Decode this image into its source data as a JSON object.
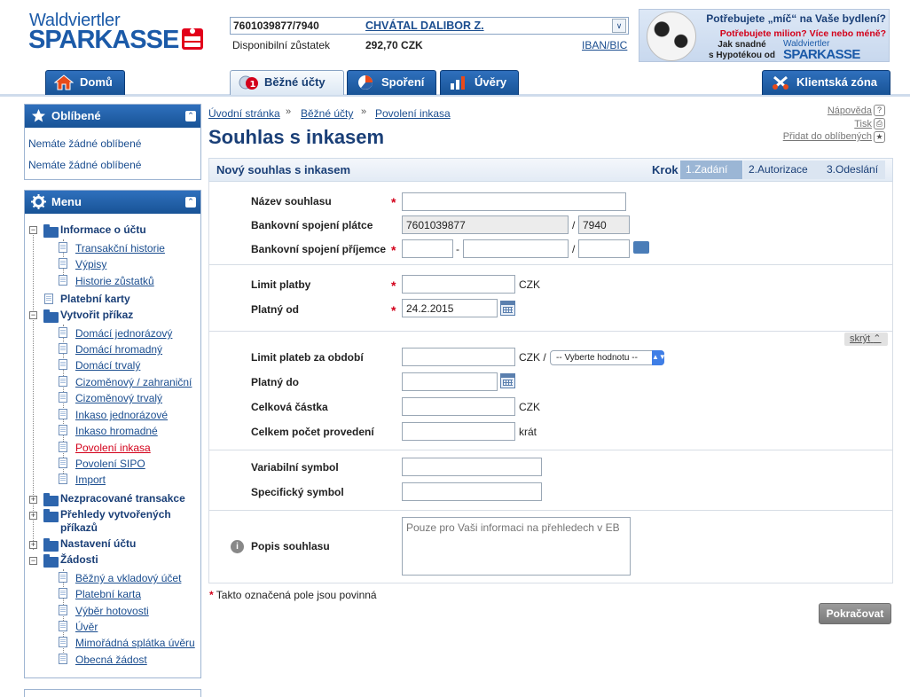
{
  "header": {
    "logo_top": "Waldviertler",
    "logo_main": "SPARKASSE",
    "account_number": "7601039877/7940",
    "account_owner": "CHVÁTAL DALIBOR Z.",
    "balance_label": "Disponibilní zůstatek",
    "balance_value": "292,70 CZK",
    "iban_link": "IBAN/BIC",
    "ad": {
      "line1": "Potřebujete „míč“ na Vaše bydlení?",
      "line2": "Potřebujete milion? Více nebo méně?",
      "line3": "Jak snadné\ns Hypotékou od",
      "logo_top": "Waldviertler",
      "logo_main": "SPARKASSE"
    }
  },
  "tabs": [
    {
      "label": "Domů",
      "icon": "home-icon",
      "active": false
    },
    {
      "label": "Běžné účty",
      "icon": "accounts-icon",
      "active": true
    },
    {
      "label": "Spoření",
      "icon": "savings-icon",
      "active": false
    },
    {
      "label": "Úvěry",
      "icon": "loans-icon",
      "active": false
    },
    {
      "label": "Klientská zóna",
      "icon": "client-zone-icon",
      "active": false
    }
  ],
  "favorites": {
    "title": "Oblíbené",
    "items": [
      "Nemáte žádné oblíbené",
      "Nemáte žádné oblíbené"
    ]
  },
  "menu": {
    "title": "Menu",
    "info": "Informace o účtu",
    "info_items": [
      "Transakční historie",
      "Výpisy",
      "Historie zůstatků"
    ],
    "cards": "Platební karty",
    "create": "Vytvořit příkaz",
    "create_items": [
      "Domácí jednorázový",
      "Domácí hromadný",
      "Domácí trvalý",
      "Cizoměnový / zahraniční",
      "Cizoměnový trvalý",
      "Inkaso jednorázové",
      "Inkaso hromadné",
      "Povolení inkasa",
      "Povolení SIPO",
      "Import"
    ],
    "unprocessed": "Nezpracované transakce",
    "overview_l1": "Přehledy vytvořených",
    "overview_l2": "příkazů",
    "settings": "Nastavení účtu",
    "requests": "Žádosti",
    "request_items": [
      "Běžný a vkladový účet",
      "Platební karta",
      "Výběr hotovosti",
      "Úvěr",
      "Mimořádná splátka úvěru",
      "Obecná žádost"
    ]
  },
  "breadcrumb": [
    "Úvodní stránka",
    "Běžné účty",
    "Povolení inkasa"
  ],
  "utility": {
    "help": "Nápověda",
    "print": "Tisk",
    "add_fav": "Přidat do oblíbených"
  },
  "page_title": "Souhlas s inkasem",
  "form": {
    "title": "Nový souhlas s inkasem",
    "krok": "Krok",
    "steps": [
      "1.Zadání",
      "2.Autorizace",
      "3.Odeslání"
    ],
    "name_label": "Název souhlasu",
    "payer_label": "Bankovní spojení plátce",
    "payer_account": "7601039877",
    "payer_bank": "7940",
    "payee_label": "Bankovní spojení příjemce",
    "limit_label": "Limit platby",
    "currency": "CZK",
    "valid_from_label": "Platný od",
    "valid_from": "24.2.2015",
    "hide_link": "skrýt",
    "period_limit_label": "Limit plateb za období",
    "currency_slash": "CZK /",
    "period_select": "-- Vyberte hodnotu --",
    "valid_to_label": "Platný do",
    "total_label": "Celková částka",
    "count_label": "Celkem počet provedení",
    "times": "krát",
    "vs_label": "Variabilní symbol",
    "ss_label": "Specifický symbol",
    "desc_label": "Popis souhlasu",
    "desc_placeholder": "Pouze pro Vaši informaci na přehledech v EB",
    "footnote": "Takto označená pole jsou povinná",
    "continue": "Pokračovat"
  }
}
